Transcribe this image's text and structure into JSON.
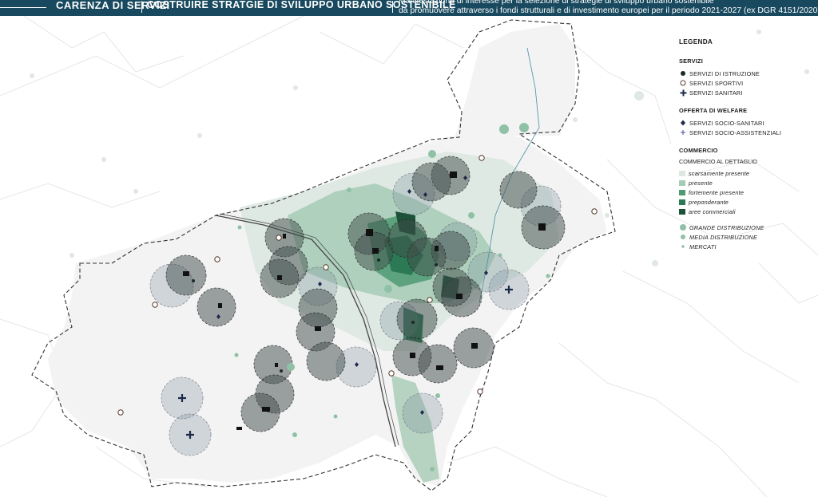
{
  "header": {
    "section": "CARENZA DI SERVIZI",
    "title": "COSTRUIRE STRATGIE DI SVILUPPO URBANO SOSTENIBILE",
    "desc_line1": "Manifestazione di interesse per la selezione di strategie di sviluppo urbano sostenibile",
    "desc_line2": "da promuovere attraverso i fondi strutturali e di investimento europei per il periodo 2021-2027 (ex DGR 4151/2020)"
  },
  "colors": {
    "header_bg": "#18495e",
    "buffer_dark": "#3f4c4a",
    "buffer_light": "#7f92a0",
    "commercio_scarsamente": "#dde8e1",
    "commercio_presente": "#a6cbb5",
    "commercio_fortemente": "#4f9a73",
    "commercio_preponderante": "#2c7a55",
    "aree_commerciali": "#1d5138",
    "distribuzione": "#8fc1a6",
    "icon_navy": "#1b2a4a"
  },
  "legend": {
    "title": "LEGENDA",
    "servizi": {
      "title": "SERVIZI",
      "items": [
        {
          "icon": "filled-dot-icon",
          "label": "SERVIZI DI ISTRUZIONE"
        },
        {
          "icon": "hollow-circle-icon",
          "label": "SERVIZI SPORTIVI"
        },
        {
          "icon": "cross-icon",
          "label": "SERVIZI SANITARI"
        }
      ]
    },
    "welfare": {
      "title": "OFFERTA DI WELFARE",
      "items": [
        {
          "icon": "diamond-icon",
          "label": "SERVIZI SOCIO-SANITARI"
        },
        {
          "icon": "small-cross-icon",
          "label": "SERVIZI SOCIO-ASSISTENZIALI"
        }
      ]
    },
    "commercio": {
      "title": "COMMERCIO",
      "subtitle": "COMMERCIO AL DETTAGLIO",
      "items": [
        {
          "label": "scarsamente presente"
        },
        {
          "label": "presente"
        },
        {
          "label": "fortemente presente"
        },
        {
          "label": "preponderante"
        },
        {
          "label": "aree commerciali"
        }
      ],
      "distribuzione": [
        {
          "label": "GRANDE DISTRIBUZIONE"
        },
        {
          "label": "MEDIA DISTRIBUZIONE"
        },
        {
          "label": "MERCATI"
        }
      ]
    }
  }
}
